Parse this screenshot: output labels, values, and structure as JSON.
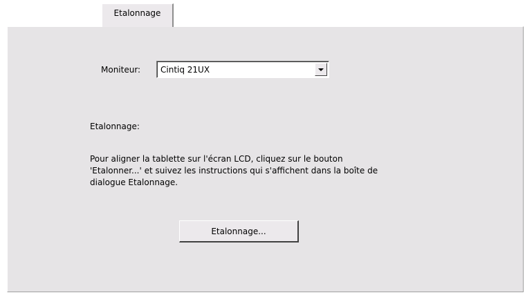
{
  "tabs": [
    {
      "label": "Etalonnage",
      "active": true
    }
  ],
  "monitor": {
    "label": "Moniteur:",
    "selected": "Cintiq 21UX"
  },
  "calibration": {
    "section_label": "Etalonnage:",
    "instructions_lines": [
      "Pour aligner la tablette sur l'écran LCD, cliquez sur le bouton",
      "'Etalonner...' et suivez les instructions qui s'affichent dans la boîte de",
      "dialogue Etalonnage."
    ],
    "button_label": "Etalonnage..."
  },
  "icons": {
    "dropdown": "chevron-down-icon"
  },
  "colors": {
    "panel_background": "#e6e4e6",
    "page_background": "#ffffff"
  }
}
